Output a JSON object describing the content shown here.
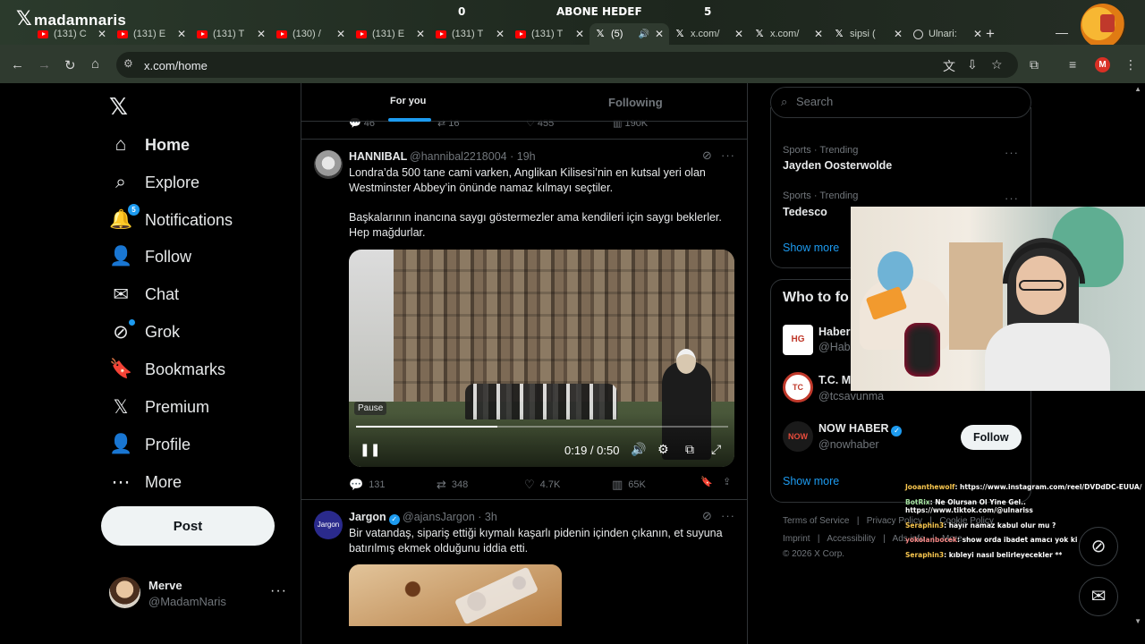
{
  "stream_overlay": {
    "brand": "madamnaris",
    "counter_left": "0",
    "counter_mid": "ABONE HEDEF",
    "counter_right": "5"
  },
  "browser": {
    "tabs": [
      {
        "title": "(131) C",
        "icon": "youtube-icon"
      },
      {
        "title": "(131) E",
        "icon": "youtube-icon"
      },
      {
        "title": "(131) T",
        "icon": "youtube-icon"
      },
      {
        "title": "(130) /",
        "icon": "youtube-icon"
      },
      {
        "title": "(131) E",
        "icon": "youtube-icon"
      },
      {
        "title": "(131) T",
        "icon": "youtube-icon"
      },
      {
        "title": "(131) T",
        "icon": "youtube-icon"
      },
      {
        "title": "(5)",
        "icon": "x-icon",
        "active": true
      },
      {
        "title": "x.com/",
        "icon": "x-icon"
      },
      {
        "title": "x.com/",
        "icon": "x-icon"
      },
      {
        "title": "sipsi (",
        "icon": "x-icon"
      },
      {
        "title": "Ulnari:",
        "icon": "globe-icon"
      }
    ],
    "new_tab": "+",
    "url": "x.com/home",
    "profile_initial": "M"
  },
  "sidebar": {
    "items": [
      {
        "label": "Home",
        "icon": "home-icon",
        "glyph": "⌂"
      },
      {
        "label": "Explore",
        "icon": "search-icon",
        "glyph": "⌕"
      },
      {
        "label": "Notifications",
        "icon": "bell-icon",
        "glyph": "🔔",
        "badge": "5"
      },
      {
        "label": "Follow",
        "icon": "follow-icon",
        "glyph": "👤"
      },
      {
        "label": "Chat",
        "icon": "mail-icon",
        "glyph": "✉"
      },
      {
        "label": "Grok",
        "icon": "grok-icon",
        "glyph": "⊘"
      },
      {
        "label": "Bookmarks",
        "icon": "bookmark-icon",
        "glyph": "🔖"
      },
      {
        "label": "Premium",
        "icon": "x-premium-icon",
        "glyph": "𝕏"
      },
      {
        "label": "Profile",
        "icon": "profile-icon",
        "glyph": "👤"
      },
      {
        "label": "More",
        "icon": "more-circle-icon",
        "glyph": "⋯"
      }
    ],
    "post_label": "Post",
    "account": {
      "name": "Merve",
      "handle": "@MadamNaris"
    }
  },
  "feed": {
    "tabs": [
      "For you",
      "Following"
    ],
    "prev_stats": {
      "replies": "46",
      "reposts": "16",
      "likes": "455",
      "views": "190K"
    },
    "tweets": [
      {
        "name": "HANNIBAL",
        "handle": "@hannibal2218004",
        "time": "· 19h",
        "text1": "Londra’da 500 tane cami varken, Anglikan Kilisesi’nin en kutsal yeri olan Westminster Abbey’in önünde namaz kılmayı seçtiler.",
        "text2": "Başkalarının inancına saygı göstermezler ama kendileri için saygı beklerler. Hep mağdurlar.",
        "video": {
          "tooltip": "Pause",
          "time": "0:19 / 0:50",
          "progress": 0.38
        },
        "stats": {
          "replies": "131",
          "reposts": "348",
          "likes": "4.7K",
          "views": "65K"
        }
      },
      {
        "name": "Jargon",
        "handle": "@ajansJargon",
        "time": "· 3h",
        "avatar_text": "Jargon",
        "text1": "Bir vatandaş, sipariş ettiği kıymalı kaşarlı pidenin içinden çıkanın,  et suyuna batırılmış ekmek olduğunu iddia etti."
      }
    ]
  },
  "right": {
    "search_placeholder": "Search",
    "trends": [
      {
        "category": "Sports · Trending",
        "name": "Jayden Oosterwolde"
      },
      {
        "category": "Sports · Trending",
        "name": "Tedesco"
      }
    ],
    "show_more": "Show more",
    "who_to_follow_title": "Who to fo",
    "who_to_follow": [
      {
        "name": "Haber",
        "handle": "@Hab",
        "avatar_text": "HG"
      },
      {
        "name": "T.C. M",
        "handle": "@tcsavunma",
        "avatar_text": "TC"
      },
      {
        "name": "NOW HABER",
        "handle": "@nowhaber",
        "avatar_text": "NOW",
        "verified": true,
        "follow_label": "Follow"
      }
    ],
    "show_more_2": "Show more",
    "footer": {
      "row1": [
        "Terms of Service",
        "|",
        "Privacy Policy",
        "|",
        "Cookie Policy"
      ],
      "row2": [
        "Imprint",
        "|",
        "Accessibility",
        "|",
        "Ads info",
        "|",
        "More ···"
      ],
      "copyright": "© 2026 X Corp."
    }
  },
  "chat": [
    {
      "user": "Jooanthewolf",
      "msg": ": https://www.instagram.com/reel/DVDdDC-EUUA/",
      "cls": "y"
    },
    {
      "user": "BotRix",
      "msg": ": Ne Olursan Ol Yine Gel.. https://www.tiktok.com/@ulnariss",
      "cls": ""
    },
    {
      "user": "Seraphin3",
      "msg": ": hayır namaz kabul olur mu ?",
      "cls": "y"
    },
    {
      "user": "yokolanbocek",
      "msg": ": show orda ibadet amacı yok ki",
      "cls": "p"
    },
    {
      "user": "Seraphin3",
      "msg": ": kıbleyi nasıl belirleyecekler **",
      "cls": "y"
    }
  ],
  "colors": {
    "accent": "#1d9bf0",
    "bg": "#000000",
    "border": "#2f3336",
    "muted": "#71767b"
  }
}
